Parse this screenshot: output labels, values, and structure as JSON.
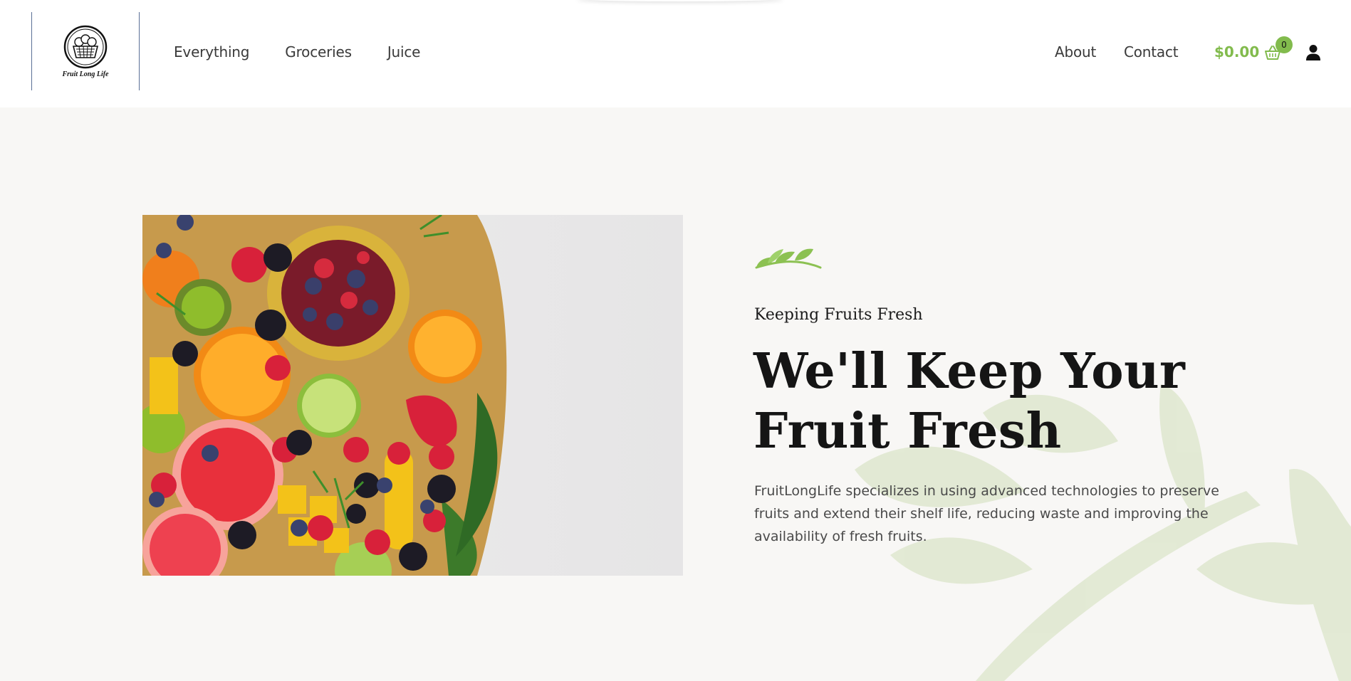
{
  "brand": {
    "logo_text": "Fruit Long Life"
  },
  "nav": {
    "left": [
      {
        "label": "Everything"
      },
      {
        "label": "Groceries"
      },
      {
        "label": "Juice"
      }
    ],
    "about": "About",
    "contact": "Contact"
  },
  "cart": {
    "amount": "$0.00",
    "count": "0"
  },
  "hero": {
    "eyebrow": "Keeping Fruits Fresh",
    "headline_line1": "We'll Keep Your",
    "headline_line2": "Fruit Fresh",
    "description": "FruitLongLife specializes in using advanced technologies to preserve fruits and extend their shelf life, reducing waste and improving the availability of fresh fruits."
  },
  "colors": {
    "accent": "#82bb4d",
    "header_bg": "#ffffff",
    "page_bg": "#f8f7f5",
    "logo_border": "#5a6f96"
  },
  "icons": [
    "cart-icon",
    "user-icon",
    "leaf-sprig-icon",
    "fruit-basket-logo"
  ]
}
